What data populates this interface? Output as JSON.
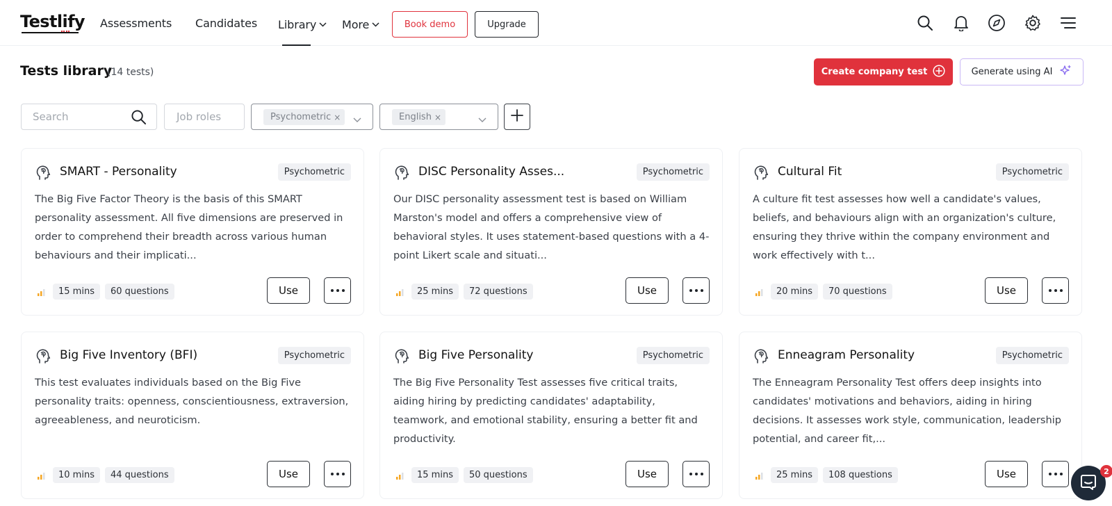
{
  "brand": {
    "logo_text": "Testlify",
    "accent_color": "#e0323c",
    "ai_border_color": "#c9b8f5",
    "level_color": "#f5a623"
  },
  "nav": {
    "assessments": "Assessments",
    "candidates": "Candidates",
    "library": "Library",
    "more": "More",
    "book_demo": "Book demo",
    "upgrade": "Upgrade",
    "icons": [
      "search-icon",
      "bell-icon",
      "compass-icon",
      "gear-icon",
      "menu-icon"
    ]
  },
  "header": {
    "title": "Tests library",
    "count": "(14 tests)",
    "create_button": "Create company test",
    "ai_button": "Generate using AI"
  },
  "filters": {
    "search_placeholder": "Search",
    "job_roles_placeholder": "Job roles",
    "type_chip": "Psychometric",
    "language_chip": "English",
    "chip_remove": "×"
  },
  "cards": [
    {
      "title": "SMART - Personality",
      "badge": "Psychometric",
      "description": "The Big Five Factor Theory is the basis of this SMART personality assessment. All five dimensions are preserved in order to comprehend their breadth across various human behaviours and their implicati...",
      "duration": "15 mins",
      "questions": "60 questions",
      "use_label": "Use"
    },
    {
      "title": "DISC Personality Asses...",
      "badge": "Psychometric",
      "description": "Our DISC personality assessment test is based on William Marston's model and offers a comprehensive view of behavioral styles. It uses statement-based questions with a 4-point Likert scale and situati...",
      "duration": "25 mins",
      "questions": "72 questions",
      "use_label": "Use"
    },
    {
      "title": "Cultural Fit",
      "badge": "Psychometric",
      "description": "A culture fit test assesses how well a candidate's values, beliefs, and behaviours align with an organization's culture, ensuring they thrive within the company environment and work effectively with t...",
      "duration": "20 mins",
      "questions": "70 questions",
      "use_label": "Use"
    },
    {
      "title": "Big Five Inventory (BFI)",
      "badge": "Psychometric",
      "description": "This test evaluates individuals based on the Big Five personality traits: openness, conscientiousness, extraversion, agreeableness, and neuroticism.",
      "duration": "10 mins",
      "questions": "44 questions",
      "use_label": "Use"
    },
    {
      "title": "Big Five Personality",
      "badge": "Psychometric",
      "description": "The Big Five Personality Test assesses five critical traits, aiding hiring by predicting candidates' adaptability, teamwork, and emotional stability, ensuring a better fit and productivity.",
      "duration": "15 mins",
      "questions": "50 questions",
      "use_label": "Use"
    },
    {
      "title": "Enneagram Personality",
      "badge": "Psychometric",
      "description": "The Enneagram Personality Test offers deep insights into candidates' motivations and behaviors, aiding in hiring decisions. It assesses work style, communication, leadership potential, and career fit,...",
      "duration": "25 mins",
      "questions": "108 questions",
      "use_label": "Use"
    }
  ],
  "chat": {
    "badge_count": "2"
  }
}
